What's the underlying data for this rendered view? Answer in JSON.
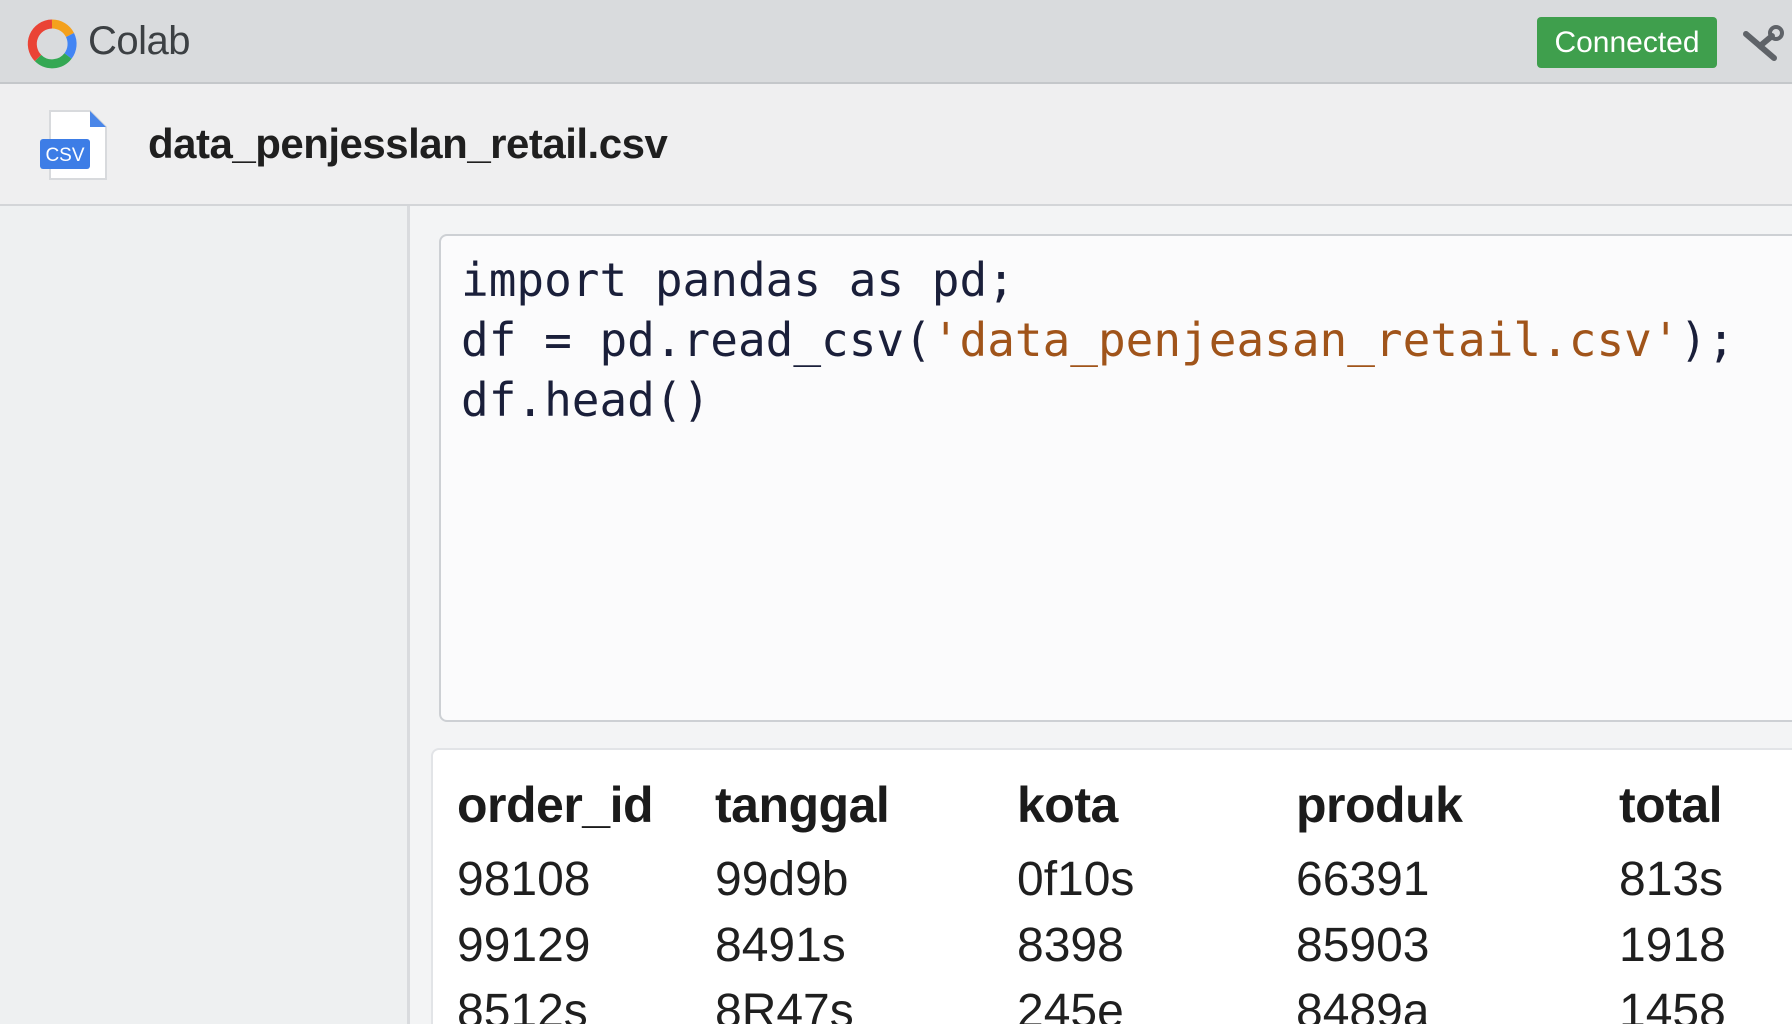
{
  "app": {
    "title": "Colab",
    "status": "Connected",
    "status_color": "#3f9f4d"
  },
  "file": {
    "icon_label": "CSV",
    "name": "data_penjesslan_retail.csv"
  },
  "code_cell": {
    "line1": "import pandas as pd;",
    "line2_prefix": "df = pd.read_csv(",
    "line2_string": "'data_penjeasan_retail.csv'",
    "line2_suffix": ");",
    "line3": "df.head()"
  },
  "output": {
    "columns": [
      "order_id",
      "tanggal",
      "kota",
      "produk",
      "total"
    ],
    "rows": [
      [
        "98108",
        "99d9b",
        "0f10s",
        "66391",
        "813s"
      ],
      [
        "99129",
        "8491s",
        "8398",
        "85903",
        "1918"
      ],
      [
        "8512s",
        "8R47s",
        "245e",
        "8489a",
        "1458"
      ]
    ]
  },
  "icons": {
    "logo": "colab-logo-icon",
    "tools": "tools-icon",
    "file": "csv-file-icon"
  }
}
